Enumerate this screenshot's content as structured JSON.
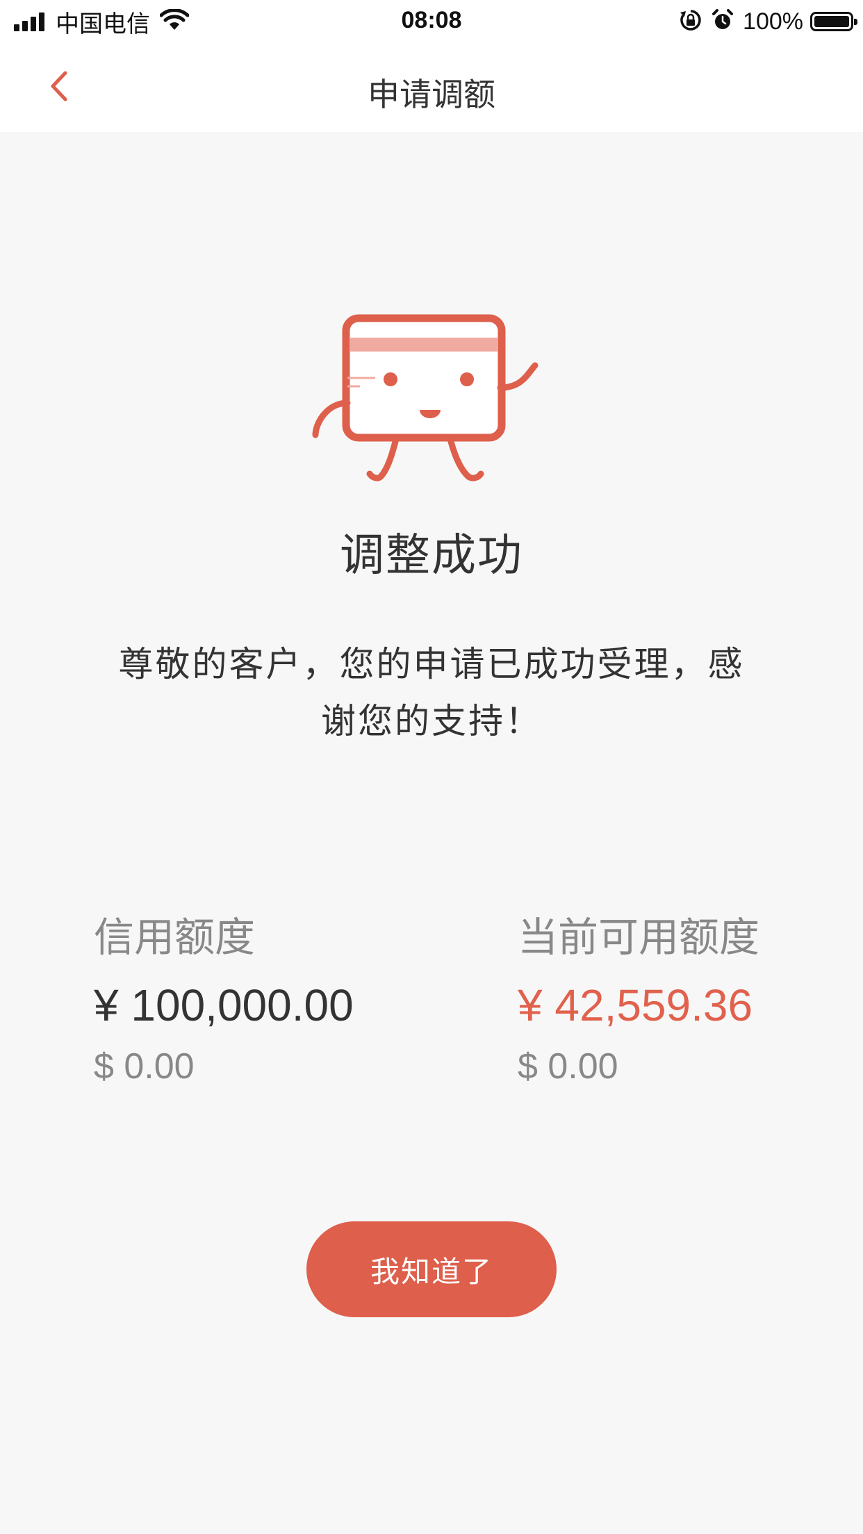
{
  "status_bar": {
    "carrier": "中国电信",
    "time": "08:08",
    "battery_percent": "100%",
    "icons": [
      "signal-icon",
      "wifi-icon",
      "rotation-lock-icon",
      "alarm-icon",
      "battery-icon"
    ]
  },
  "nav": {
    "title": "申请调额",
    "back_icon": "chevron-left-icon"
  },
  "result": {
    "illustration": "credit-card-mascot-icon",
    "title": "调整成功",
    "message": "尊敬的客户，您的申请已成功受理，感谢您的支持！"
  },
  "credit": {
    "limit_label": "信用额度",
    "limit_cny": "¥ 100,000.00",
    "limit_usd": "$ 0.00",
    "available_label": "当前可用额度",
    "available_cny": "¥ 42,559.36",
    "available_usd": "$ 0.00"
  },
  "actions": {
    "ok_label": "我知道了"
  },
  "colors": {
    "accent": "#de5f4b",
    "background": "#f7f7f7",
    "muted_text": "#888888"
  }
}
